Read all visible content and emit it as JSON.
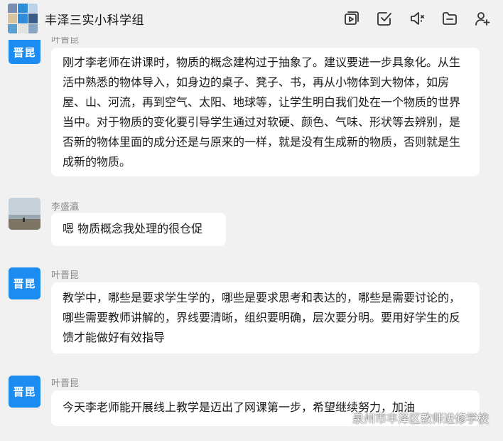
{
  "header": {
    "title": "丰泽三实小科学组",
    "icons": [
      "video-icon",
      "checkbox-icon",
      "speaker-icon",
      "folder-icon",
      "add-member-icon"
    ]
  },
  "messages": [
    {
      "sender": "叶晋昆",
      "avatar_text": "晋昆",
      "text": "刚才李老师在讲课时，物质的概念建构过于抽象了。建议要进一步具象化。从生活中熟悉的物体导入，如身边的桌子、凳子、书，再从小物体到大物体，如房屋、山、河流，再到空气、太阳、地球等，让学生明白我们处在一个物质的世界当中。对于物质的变化要引导学生通过对软硬、颜色、气味、形状等去辨别，是否新的物体里面的成分还是与原来的一样，就是没有生成新的物质，否则就是生成新的物质。"
    },
    {
      "sender": "李盛瀛",
      "text": "嗯 物质概念我处理的很仓促"
    },
    {
      "sender": "叶晋昆",
      "avatar_text": "晋昆",
      "text": "教学中，哪些是要求学生学的，哪些是要求思考和表达的，哪些是需要讨论的，哪些需要教师讲解的，界线要清晰，组织要明确，层次要分明。要用好学生的反馈才能做好有效指导"
    },
    {
      "sender": "叶晋昆",
      "avatar_text": "晋昆",
      "text": "今天李老师能开展线上教学是迈出了网课第一步，希望继续努力，加油"
    }
  ],
  "watermark": "泉州市丰泽区教师进修学校",
  "colors": {
    "avatar_blue": "#1d8cf0",
    "bubble": "#ffffff",
    "background": "#f1f1f1"
  }
}
